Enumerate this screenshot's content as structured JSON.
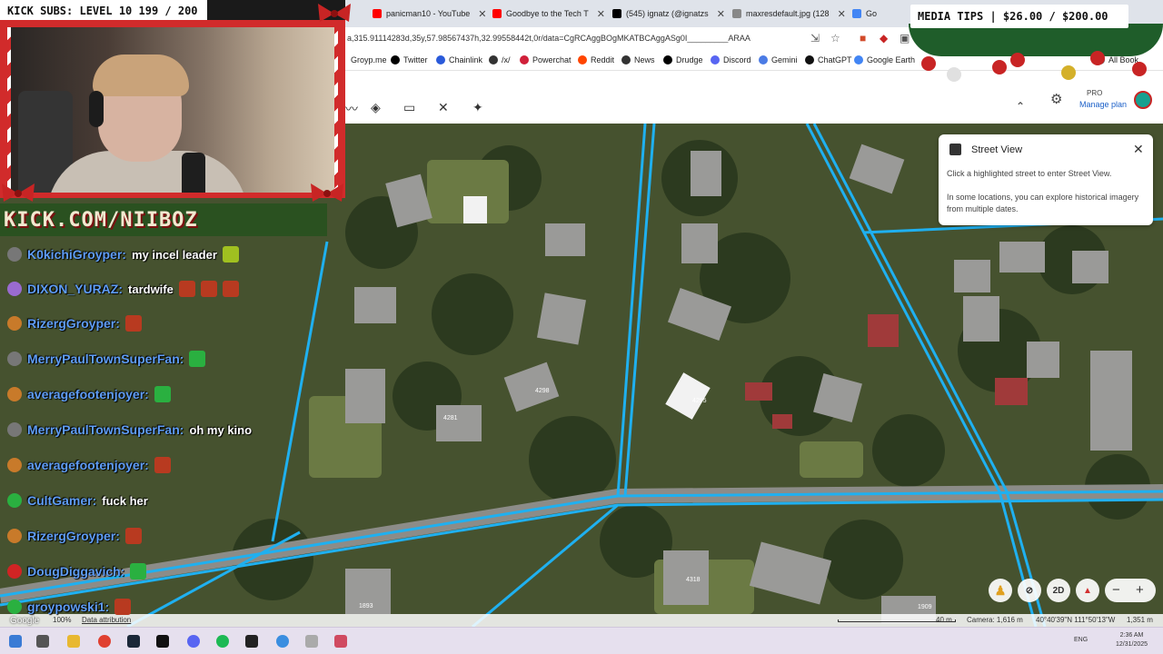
{
  "overlay": {
    "kick_subs": "KICK SUBS: LEVEL 10 199 / 200",
    "media_tips": "MEDIA TIPS | $26.00 / $200.00",
    "kick_url": "KICK.COM/NIIBOZ"
  },
  "browser": {
    "tabs": [
      {
        "title": "panicman10 - YouTube",
        "icon_color": "#ff0000"
      },
      {
        "title": "Goodbye to the Tech T",
        "icon_color": "#ff0000"
      },
      {
        "title": "(545) ignatz (@ignatzs",
        "icon_color": "#000000"
      },
      {
        "title": "maxresdefault.jpg (128",
        "icon_color": "#888888"
      },
      {
        "title": "Go",
        "icon_color": "#4285f4"
      }
    ],
    "url": "a,315.91114283d,35y,57.98567437h,32.99558442t,0r/data=CgRCAggBOgMKATBCAggASg0I_________ARAA",
    "bookmarks": [
      {
        "label": "Groyp.me",
        "icon_color": "#888888"
      },
      {
        "label": "Twitter",
        "icon_color": "#000000"
      },
      {
        "label": "Chainlink",
        "icon_color": "#2a5ada"
      },
      {
        "label": "/x/",
        "icon_color": "#333333"
      },
      {
        "label": "Powerchat",
        "icon_color": "#d0203a"
      },
      {
        "label": "Reddit",
        "icon_color": "#ff4500"
      },
      {
        "label": "News",
        "icon_color": "#333333"
      },
      {
        "label": "Drudge",
        "icon_color": "#000000"
      },
      {
        "label": "Discord",
        "icon_color": "#5865f2"
      },
      {
        "label": "Gemini",
        "icon_color": "#4b7be5"
      },
      {
        "label": "ChatGPT",
        "icon_color": "#111111"
      },
      {
        "label": "Google Earth",
        "icon_color": "#4285f4"
      },
      {
        "label": "All Book",
        "icon_color": "#666666"
      }
    ]
  },
  "earth": {
    "pro": "PRO",
    "manage_plan": "Manage plan",
    "street_view": {
      "title": "Street View",
      "line1": "Click a highlighted street to enter Street View.",
      "line2": "In some locations, you can explore historical imagery from multiple dates."
    },
    "controls": {
      "two_d": "2D"
    },
    "status": {
      "logo": "Google",
      "zoom": "100%",
      "attribution": "Data attribution",
      "scale": "40 m",
      "camera": "Camera: 1,616 m",
      "coords": "40°40'39\"N 111°50'13\"W",
      "elevation": "1,351 m"
    },
    "house_numbers": [
      "4298",
      "4281",
      "4295",
      "4318",
      "1893",
      "1909"
    ]
  },
  "chat": [
    {
      "user": "K0kichiGroyper:",
      "message": "my incel leader",
      "badge": "#777777",
      "emotes": [
        "#a0c020"
      ]
    },
    {
      "user": "DIXON_YURAZ:",
      "message": "tardwife",
      "badge": "#9a6bd0",
      "emotes": [
        "#b83a20",
        "#b83a20",
        "#b83a20"
      ]
    },
    {
      "user": "RizergGroyper:",
      "message": "",
      "badge": "#c87a2a",
      "emotes": [
        "#b83a20"
      ]
    },
    {
      "user": "MerryPaulTownSuperFan:",
      "message": "",
      "badge": "#777777",
      "emotes": [
        "#2ab040"
      ]
    },
    {
      "user": "averagefootenjoyer:",
      "message": "",
      "badge": "#c87a2a",
      "emotes": [
        "#2ab040"
      ]
    },
    {
      "user": "MerryPaulTownSuperFan:",
      "message": "oh my kino",
      "badge": "#777777",
      "emotes": []
    },
    {
      "user": "averagefootenjoyer:",
      "message": "",
      "badge": "#c87a2a",
      "emotes": [
        "#b83a20"
      ]
    },
    {
      "user": "CultGamer:",
      "message": "fuck her",
      "badge": "#2ab040",
      "emotes": []
    },
    {
      "user": "RizergGroyper:",
      "message": "",
      "badge": "#c87a2a",
      "emotes": [
        "#b83a20"
      ]
    },
    {
      "user": "DougDiggavich:",
      "message": "",
      "badge": "#d02424",
      "emotes": [
        "#2ab040"
      ]
    },
    {
      "user": "groypowski1:",
      "message": "",
      "badge": "#2ab040",
      "emotes": [
        "#b83a20"
      ]
    }
  ],
  "taskbar": {
    "lang": "ENG",
    "time": "2:36 AM",
    "date": "12/31/2025"
  }
}
